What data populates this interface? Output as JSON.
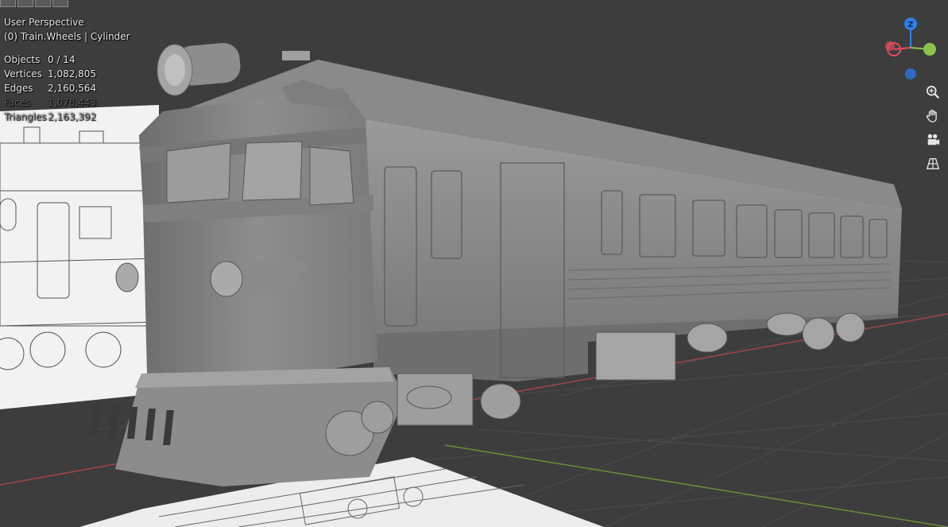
{
  "viewport": {
    "view_name": "User Perspective",
    "selection_info": "(0) Train.Wheels | Cylinder"
  },
  "stats": [
    {
      "label": "Objects",
      "value": "0 / 14"
    },
    {
      "label": "Vertices",
      "value": "1,082,805"
    },
    {
      "label": "Edges",
      "value": "2,160,564"
    },
    {
      "label": "Faces",
      "value": "1,078,443"
    },
    {
      "label": "Triangles",
      "value": "2,163,392"
    }
  ],
  "gizmo": {
    "z_label": "Z",
    "x_color": "#e74c5a",
    "y_color": "#8bc34a",
    "z_color": "#2f80ed"
  },
  "nav_tools": [
    {
      "name": "zoom-icon"
    },
    {
      "name": "hand-pan-icon"
    },
    {
      "name": "camera-icon"
    },
    {
      "name": "grid-perspective-icon"
    }
  ],
  "colors": {
    "background": "#3d3d3d",
    "grid": "#4a4a4a",
    "x_axis": "#a34646",
    "y_axis": "#6a8f3a",
    "model": "#8c8c8c"
  }
}
